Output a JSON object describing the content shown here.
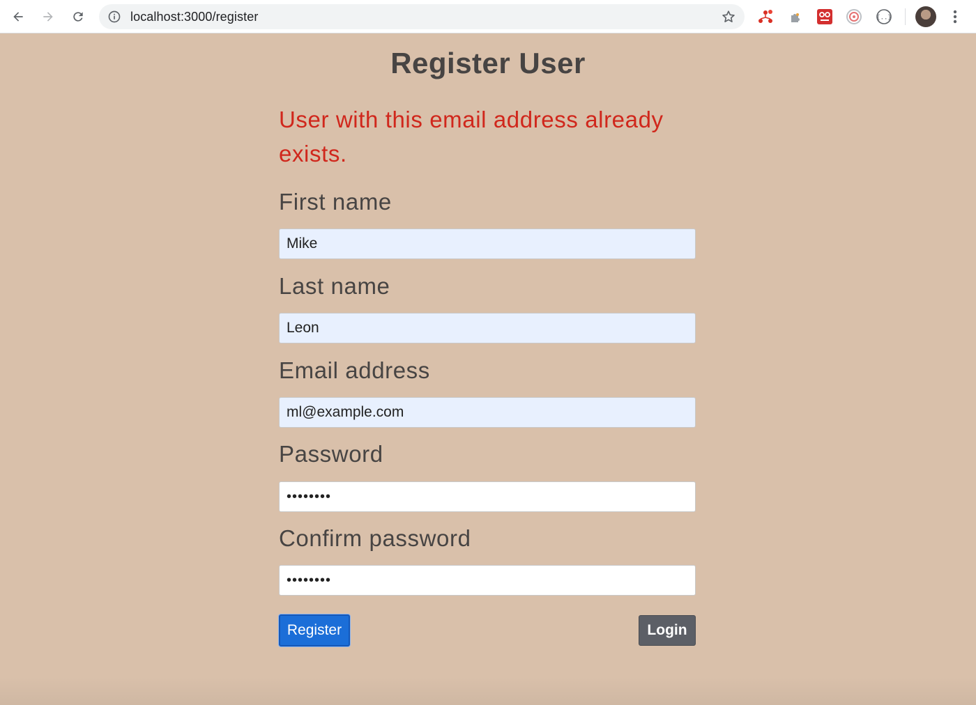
{
  "browser": {
    "url": "localhost:3000/register"
  },
  "page": {
    "title": "Register User",
    "error_message": "User with this email address already exists.",
    "fields": {
      "first_name": {
        "label": "First name",
        "value": "Mike"
      },
      "last_name": {
        "label": "Last name",
        "value": "Leon"
      },
      "email": {
        "label": "Email address",
        "value": "ml@example.com"
      },
      "password": {
        "label": "Password",
        "value": "••••••••"
      },
      "confirm_password": {
        "label": "Confirm password",
        "value": "••••••••"
      }
    },
    "buttons": {
      "register": "Register",
      "login": "Login"
    }
  },
  "colors": {
    "page_background": "#d9c0aa",
    "error_text": "#d0271c",
    "register_button": "#1b6ed8",
    "login_button": "#5c5f66",
    "autofill_field": "#e8f0fe"
  },
  "icons": {
    "back": "arrow-left-icon",
    "forward": "arrow-right-icon",
    "reload": "reload-icon",
    "site_info": "info-icon",
    "bookmark": "star-icon",
    "menu": "more-vert-icon"
  }
}
